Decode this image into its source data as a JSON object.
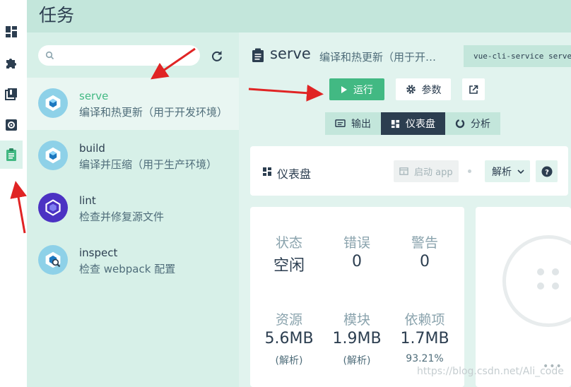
{
  "page": {
    "title": "任务"
  },
  "rail": {
    "items": [
      {
        "name": "dashboard-icon",
        "active": false
      },
      {
        "name": "plugins-icon",
        "active": false
      },
      {
        "name": "dependencies-icon",
        "active": false
      },
      {
        "name": "configuration-icon",
        "active": false
      },
      {
        "name": "tasks-icon",
        "active": true
      }
    ]
  },
  "tasklist": {
    "search": {
      "placeholder": "",
      "value": ""
    },
    "tasks": [
      {
        "name": "serve",
        "description": "编译和热更新（用于开发环境）",
        "icon": "webpack-icon"
      },
      {
        "name": "build",
        "description": "编译并压缩（用于生产环境）",
        "icon": "webpack-icon"
      },
      {
        "name": "lint",
        "description": "检查并修复源文件",
        "icon": "eslint-icon"
      },
      {
        "name": "inspect",
        "description": "检查 webpack 配置",
        "icon": "webpack-inspect-icon"
      }
    ]
  },
  "detail": {
    "title": "serve",
    "description": "编译和热更新（用于开发环境）",
    "command": "vue-cli-service serve",
    "run_label": "运行",
    "params_label": "参数",
    "tabs": [
      "输出",
      "仪表盘",
      "分析"
    ],
    "active_tab": "仪表盘",
    "dashboard": {
      "title": "仪表盘",
      "start_app_label": "启动 app",
      "analyze_label": "解析"
    },
    "stats": {
      "status_label": "状态",
      "status_value": "空闲",
      "errors_label": "错误",
      "errors_value": "0",
      "warnings_label": "警告",
      "warnings_value": "0",
      "assets_label": "资源",
      "assets_value": "5.6MB",
      "assets_sub": "(解析)",
      "modules_label": "模块",
      "modules_value": "1.9MB",
      "modules_sub": "(解析)",
      "deps_label": "依赖项",
      "deps_value": "1.7MB",
      "deps_sub": "93.21%"
    },
    "more": "•••"
  },
  "watermark": "https://blog.csdn.net/Ali_code",
  "colors": {
    "accent": "#42b983",
    "dark": "#2c3e50",
    "arrow": "#e02424"
  }
}
